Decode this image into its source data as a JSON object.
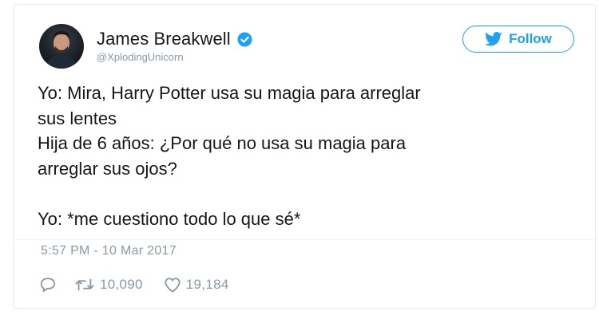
{
  "tweet": {
    "author": {
      "display_name": "James Breakwell",
      "handle": "@XplodingUnicorn",
      "verified": true
    },
    "follow_label": "Follow",
    "text_lines": [
      "Yo: Mira, Harry Potter usa su magia para arreglar",
      "sus lentes",
      "Hija de 6 años: ¿Por qué no usa su magia para",
      "arreglar sus ojos?",
      "",
      "Yo: *me cuestiono todo lo que sé*"
    ],
    "timestamp": "5:57 PM - 10 Mar 2017",
    "retweets": "10,090",
    "likes": "19,184",
    "icons": {
      "verified": "verified-badge-icon",
      "follow": "twitter-bird-icon",
      "reply": "reply-icon",
      "retweet": "retweet-icon",
      "like": "heart-icon"
    },
    "colors": {
      "accent": "#1da1f2",
      "secondary_text": "#8899a6",
      "primary_text": "#14171a"
    }
  }
}
